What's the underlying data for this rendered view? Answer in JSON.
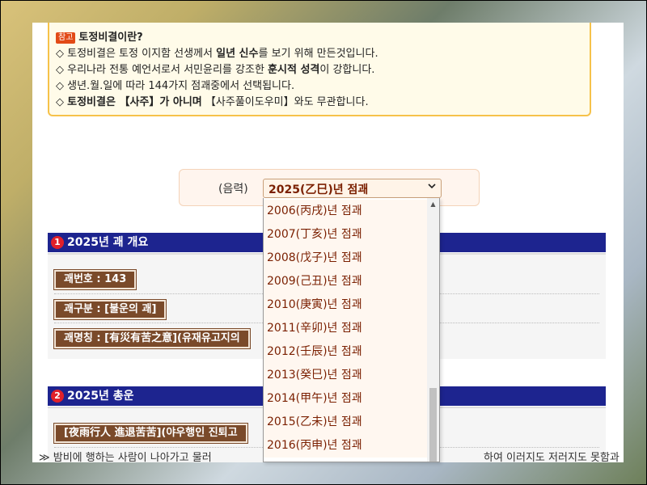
{
  "note": {
    "badge": "참고",
    "title": "토정비결이란?",
    "lines": [
      [
        "◇ 토정비결은 토정 이지함 선생께서 ",
        "일년 신수",
        "를 보기 위해 만든것입니다."
      ],
      [
        "◇ 우리나라 전통 예언서로서 서민윤리를 강조한 ",
        "훈시적 성격",
        "이 강합니다."
      ],
      [
        "◇ 생년.월.일에 따라 144가지 점괘중에서 선택됩니다.",
        "",
        ""
      ],
      [
        "◇ ",
        "토정비결은 【사주】가 아니며",
        " 【사주풀이도우미】와도 무관합니다."
      ]
    ]
  },
  "year_picker": {
    "label": "(음력)",
    "selected": "2025(乙巳)년 점괘",
    "chevron_icon": "chevron-down-icon",
    "options": [
      "2006(丙戌)년 점괘",
      "2007(丁亥)년 점괘",
      "2008(戊子)년 점괘",
      "2009(己丑)년 점괘",
      "2010(庚寅)년 점괘",
      "2011(辛卯)년 점괘",
      "2012(壬辰)년 점괘",
      "2013(癸巳)년 점괘",
      "2014(甲午)년 점괘",
      "2015(乙未)년 점괘",
      "2016(丙申)년 점괘"
    ]
  },
  "section1": {
    "num": "1",
    "title": "2025년 괘 개요",
    "rows": [
      "괘번호 : 143",
      "괘구분 : [불운의 괘]",
      "괘명칭 : [有災有苦之意](유재유고지의"
    ]
  },
  "section2": {
    "num": "2",
    "title": "2025년 총운",
    "tag": "[夜雨行人 進退苦苦](야우행인 진퇴고",
    "text": "≫  밤비에 행하는 사람이 나아가고 물러",
    "text_right": "하여 이러지도 저러지도 못함과"
  },
  "colors": {
    "section_header": "#1d248f",
    "tag_bg": "#7a4a2a",
    "option_text": "#7a1f00",
    "note_border": "#f6c24a"
  }
}
